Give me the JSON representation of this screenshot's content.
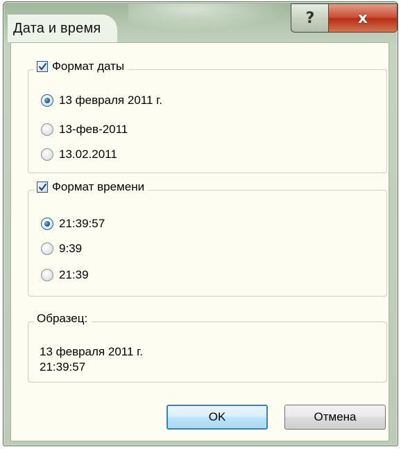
{
  "window": {
    "title": "Дата и время",
    "help_glyph": "?",
    "close_glyph": "x"
  },
  "date_group": {
    "label": "Формат даты",
    "checked": true,
    "options": [
      {
        "label": "13 февраля 2011 г.",
        "selected": true
      },
      {
        "label": "13-фев-2011",
        "selected": false
      },
      {
        "label": "13.02.2011",
        "selected": false
      }
    ]
  },
  "time_group": {
    "label": "Формат времени",
    "checked": true,
    "options": [
      {
        "label": "21:39:57",
        "selected": true
      },
      {
        "label": "9:39",
        "selected": false
      },
      {
        "label": "21:39",
        "selected": false
      }
    ]
  },
  "sample_group": {
    "label": "Образец:",
    "line1": "13 февраля 2011 г.",
    "line2": "21:39:57"
  },
  "buttons": {
    "ok": "OK",
    "cancel": "Отмена"
  },
  "colors": {
    "frame": "#bccbb8",
    "client_bg": "#fdfdf2",
    "close_red": "#cb4d33",
    "ok_blue": "#3c7fb1"
  },
  "icons": {
    "help": "question-icon",
    "close": "close-icon",
    "check": "checkmark-icon"
  }
}
